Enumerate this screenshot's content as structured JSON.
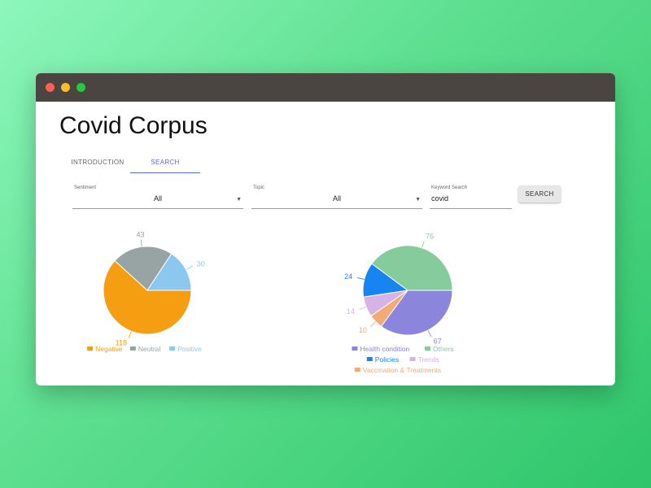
{
  "app": {
    "title": "Covid Corpus",
    "tabs": [
      {
        "label": "INTRODUCTION",
        "active": false
      },
      {
        "label": "SEARCH",
        "active": true
      }
    ]
  },
  "filters": {
    "sentiment": {
      "label": "Sentiment",
      "value": "All"
    },
    "topic": {
      "label": "Topic",
      "value": "All"
    },
    "keyword": {
      "label": "Keyword Search",
      "value": "covid"
    },
    "search_button": "SEARCH"
  },
  "chart_data": [
    {
      "type": "pie",
      "labels": [
        "Negative",
        "Neutral",
        "Positive"
      ],
      "values": [
        118,
        43,
        30
      ],
      "colors": [
        "#f59e12",
        "#98a3a3",
        "#8cc7ef"
      ],
      "legend": "bottom"
    },
    {
      "type": "pie",
      "labels": [
        "Health condition",
        "Others",
        "Policies",
        "Trends",
        "Vaccination & Treatments"
      ],
      "values": [
        67,
        76,
        24,
        14,
        10
      ],
      "order": [
        0,
        4,
        3,
        2,
        1
      ],
      "colors": [
        "#8b86dc",
        "#86cb9b",
        "#1784f2",
        "#d6b3e4",
        "#f2aa78"
      ],
      "legend": "bottom"
    }
  ]
}
